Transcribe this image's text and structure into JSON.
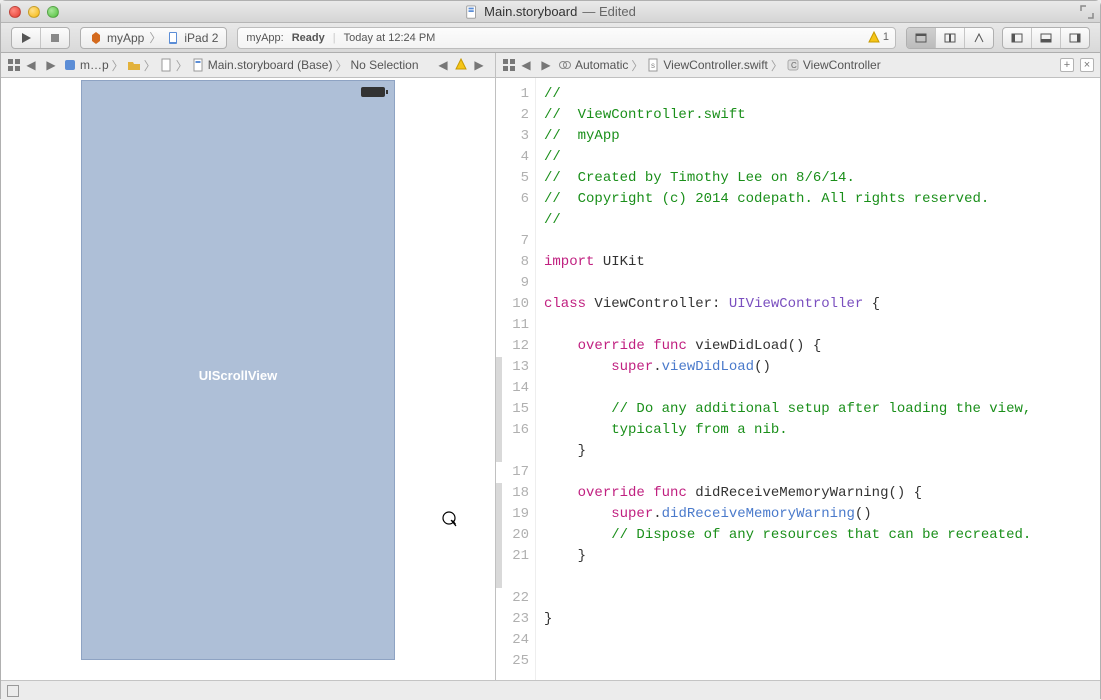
{
  "title": {
    "filename": "Main.storyboard",
    "suffix": "— Edited"
  },
  "toolbar": {
    "scheme_app": "myApp",
    "scheme_device": "iPad 2",
    "activity_app": "myApp:",
    "activity_status": "Ready",
    "activity_time": "Today at 12:24 PM",
    "warning_count": "1"
  },
  "jumpbar_left": {
    "item0": "m…p",
    "item1": "Main.storyboard (Base)",
    "item2": "No Selection"
  },
  "jumpbar_right": {
    "mode": "Automatic",
    "file": "ViewController.swift",
    "class": "ViewController"
  },
  "canvas": {
    "label": "UIScrollView"
  },
  "code": {
    "l1": "//",
    "l2a": "//  ",
    "l2b": "ViewController.swift",
    "l3a": "//  ",
    "l3b": "myApp",
    "l4": "//",
    "l5a": "//  ",
    "l5b": "Created by Timothy Lee on 8/6/14.",
    "l6a": "//  ",
    "l6b": "Copyright (c) 2014 codepath. All rights reserved.",
    "l7": "//",
    "l8": "",
    "l9a": "import",
    "l9b": " UIKit",
    "l10": "",
    "l11a": "class",
    "l11b": " ViewController",
    "l11c": ": ",
    "l11d": "UIViewController",
    "l11e": " {",
    "l12": "",
    "l13a": "    ",
    "l13b": "override",
    "l13c": " ",
    "l13d": "func",
    "l13e": " viewDidLoad() {",
    "l14a": "        ",
    "l14b": "super",
    "l14c": ".",
    "l14d": "viewDidLoad",
    "l14e": "()",
    "l15": "",
    "l16a": "        ",
    "l16b": "// Do any additional setup after loading the view, typically from a nib.",
    "l17": "    }",
    "l18": "",
    "l19a": "    ",
    "l19b": "override",
    "l19c": " ",
    "l19d": "func",
    "l19e": " didReceiveMemoryWarning() {",
    "l20a": "        ",
    "l20b": "super",
    "l20c": ".",
    "l20d": "didReceiveMemoryWarning",
    "l20e": "()",
    "l21a": "        ",
    "l21b": "// Dispose of any resources that can be recreated.",
    "l22": "    }",
    "l23": "",
    "l24": "",
    "l25": "}"
  },
  "line_numbers": [
    "1",
    "2",
    "3",
    "4",
    "5",
    "6",
    "7",
    "8",
    "9",
    "10",
    "11",
    "12",
    "13",
    "14",
    "15",
    "16",
    "17",
    "18",
    "19",
    "20",
    "21",
    "22",
    "23",
    "24",
    "25"
  ]
}
